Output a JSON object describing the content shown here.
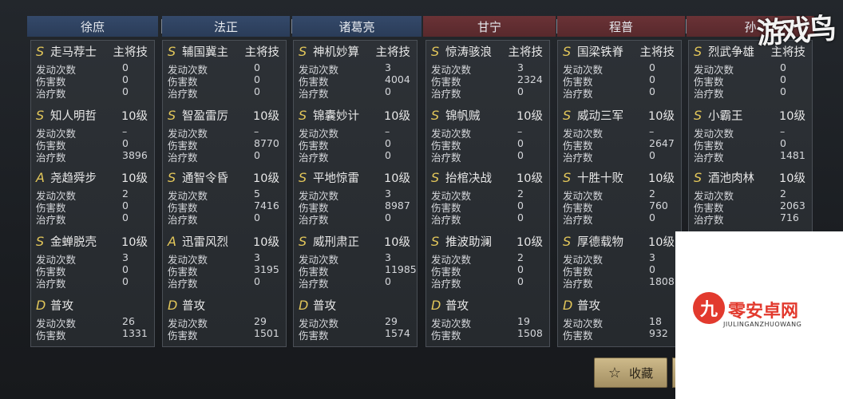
{
  "heroes": [
    {
      "name": "徐庶",
      "side": "blue"
    },
    {
      "name": "法正",
      "side": "blue"
    },
    {
      "name": "诸葛亮",
      "side": "blue"
    },
    {
      "name": "甘宁",
      "side": "red"
    },
    {
      "name": "程普",
      "side": "red"
    },
    {
      "name": "孙",
      "side": "red"
    }
  ],
  "labels": {
    "trigger": "发动次数",
    "damage": "伤害数",
    "heal": "治疗数",
    "main_skill": "主将技",
    "level": "10级",
    "normal_attack": "普攻"
  },
  "columns": [
    {
      "skills": [
        {
          "grade": "S",
          "name": "走马荐士",
          "tag": "主将技",
          "stats": [
            "0",
            "0",
            "0"
          ]
        },
        {
          "grade": "S",
          "name": "知人明哲",
          "tag": "10级",
          "stats": [
            "–",
            "0",
            "3896"
          ]
        },
        {
          "grade": "A",
          "name": "尧趋舜步",
          "tag": "10级",
          "stats": [
            "2",
            "0",
            "0"
          ]
        },
        {
          "grade": "S",
          "name": "金蝉脱壳",
          "tag": "10级",
          "stats": [
            "3",
            "0",
            "0"
          ]
        },
        {
          "grade": "D",
          "name": "普攻",
          "tag": "",
          "stats": [
            "26",
            "1331"
          ]
        }
      ]
    },
    {
      "skills": [
        {
          "grade": "S",
          "name": "辅国冀主",
          "tag": "主将技",
          "stats": [
            "0",
            "0",
            "0"
          ]
        },
        {
          "grade": "S",
          "name": "智盈雷厉",
          "tag": "10级",
          "stats": [
            "–",
            "8770",
            "0"
          ]
        },
        {
          "grade": "S",
          "name": "通智令昏",
          "tag": "10级",
          "stats": [
            "5",
            "7416",
            "0"
          ]
        },
        {
          "grade": "A",
          "name": "迅雷风烈",
          "tag": "10级",
          "stats": [
            "3",
            "3195",
            "0"
          ]
        },
        {
          "grade": "D",
          "name": "普攻",
          "tag": "",
          "stats": [
            "29",
            "1501"
          ]
        }
      ]
    },
    {
      "skills": [
        {
          "grade": "S",
          "name": "神机妙算",
          "tag": "主将技",
          "stats": [
            "3",
            "4004",
            "0"
          ]
        },
        {
          "grade": "S",
          "name": "锦囊妙计",
          "tag": "10级",
          "stats": [
            "–",
            "0",
            "0"
          ]
        },
        {
          "grade": "S",
          "name": "平地惊雷",
          "tag": "10级",
          "stats": [
            "3",
            "8987",
            "0"
          ]
        },
        {
          "grade": "S",
          "name": "威刑肃正",
          "tag": "10级",
          "stats": [
            "3",
            "11985",
            "0"
          ]
        },
        {
          "grade": "D",
          "name": "普攻",
          "tag": "",
          "stats": [
            "29",
            "1574"
          ]
        }
      ]
    },
    {
      "skills": [
        {
          "grade": "S",
          "name": "惊涛骇浪",
          "tag": "主将技",
          "stats": [
            "3",
            "2324",
            "0"
          ]
        },
        {
          "grade": "S",
          "name": "锦帆贼",
          "tag": "10级",
          "stats": [
            "–",
            "0",
            "0"
          ]
        },
        {
          "grade": "S",
          "name": "抬棺决战",
          "tag": "10级",
          "stats": [
            "2",
            "0",
            "0"
          ]
        },
        {
          "grade": "S",
          "name": "推波助澜",
          "tag": "10级",
          "stats": [
            "2",
            "0",
            "0"
          ]
        },
        {
          "grade": "D",
          "name": "普攻",
          "tag": "",
          "stats": [
            "19",
            "1508"
          ]
        }
      ]
    },
    {
      "skills": [
        {
          "grade": "S",
          "name": "国梁铁脊",
          "tag": "主将技",
          "stats": [
            "0",
            "0",
            "0"
          ]
        },
        {
          "grade": "S",
          "name": "威动三军",
          "tag": "10级",
          "stats": [
            "–",
            "2647",
            "0"
          ]
        },
        {
          "grade": "S",
          "name": "十胜十败",
          "tag": "10级",
          "stats": [
            "2",
            "760",
            "0"
          ]
        },
        {
          "grade": "S",
          "name": "厚德载物",
          "tag": "10级",
          "stats": [
            "3",
            "0",
            "1808"
          ]
        },
        {
          "grade": "D",
          "name": "普攻",
          "tag": "",
          "stats": [
            "18",
            "932"
          ]
        }
      ]
    },
    {
      "skills": [
        {
          "grade": "S",
          "name": "烈武争雄",
          "tag": "主将技",
          "stats": [
            "0",
            "0",
            "0"
          ]
        },
        {
          "grade": "S",
          "name": "小霸王",
          "tag": "10级",
          "stats": [
            "–",
            "0",
            "1481"
          ]
        },
        {
          "grade": "S",
          "name": "酒池肉林",
          "tag": "10级",
          "stats": [
            "2",
            "2063",
            "716"
          ]
        }
      ]
    }
  ],
  "buttons": {
    "favorite": "收藏"
  },
  "watermarks": {
    "top_right": "游戏鸟",
    "brand": "零安卓网",
    "brand_sub": "JIULINGANZHUOWANG",
    "brand_logo": "九"
  }
}
